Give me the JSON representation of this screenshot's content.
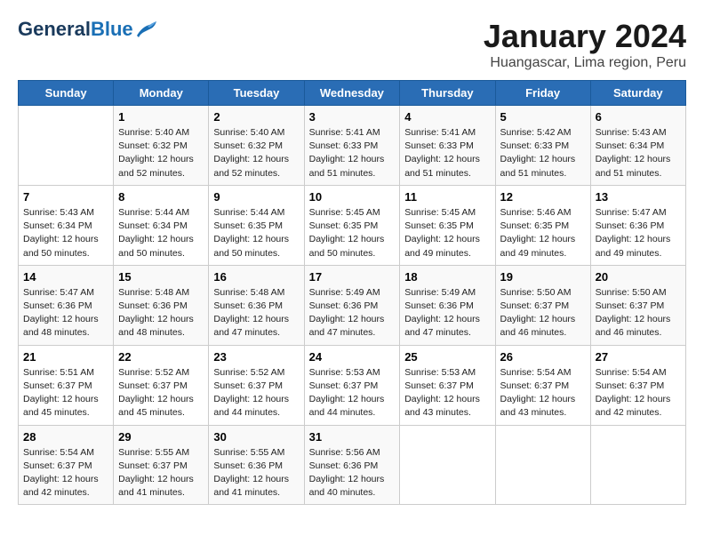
{
  "logo": {
    "line1": "General",
    "line2": "Blue"
  },
  "title": "January 2024",
  "subtitle": "Huangascar, Lima region, Peru",
  "days_of_week": [
    "Sunday",
    "Monday",
    "Tuesday",
    "Wednesday",
    "Thursday",
    "Friday",
    "Saturday"
  ],
  "weeks": [
    [
      {
        "num": "",
        "info": ""
      },
      {
        "num": "1",
        "info": "Sunrise: 5:40 AM\nSunset: 6:32 PM\nDaylight: 12 hours\nand 52 minutes."
      },
      {
        "num": "2",
        "info": "Sunrise: 5:40 AM\nSunset: 6:32 PM\nDaylight: 12 hours\nand 52 minutes."
      },
      {
        "num": "3",
        "info": "Sunrise: 5:41 AM\nSunset: 6:33 PM\nDaylight: 12 hours\nand 51 minutes."
      },
      {
        "num": "4",
        "info": "Sunrise: 5:41 AM\nSunset: 6:33 PM\nDaylight: 12 hours\nand 51 minutes."
      },
      {
        "num": "5",
        "info": "Sunrise: 5:42 AM\nSunset: 6:33 PM\nDaylight: 12 hours\nand 51 minutes."
      },
      {
        "num": "6",
        "info": "Sunrise: 5:43 AM\nSunset: 6:34 PM\nDaylight: 12 hours\nand 51 minutes."
      }
    ],
    [
      {
        "num": "7",
        "info": "Sunrise: 5:43 AM\nSunset: 6:34 PM\nDaylight: 12 hours\nand 50 minutes."
      },
      {
        "num": "8",
        "info": "Sunrise: 5:44 AM\nSunset: 6:34 PM\nDaylight: 12 hours\nand 50 minutes."
      },
      {
        "num": "9",
        "info": "Sunrise: 5:44 AM\nSunset: 6:35 PM\nDaylight: 12 hours\nand 50 minutes."
      },
      {
        "num": "10",
        "info": "Sunrise: 5:45 AM\nSunset: 6:35 PM\nDaylight: 12 hours\nand 50 minutes."
      },
      {
        "num": "11",
        "info": "Sunrise: 5:45 AM\nSunset: 6:35 PM\nDaylight: 12 hours\nand 49 minutes."
      },
      {
        "num": "12",
        "info": "Sunrise: 5:46 AM\nSunset: 6:35 PM\nDaylight: 12 hours\nand 49 minutes."
      },
      {
        "num": "13",
        "info": "Sunrise: 5:47 AM\nSunset: 6:36 PM\nDaylight: 12 hours\nand 49 minutes."
      }
    ],
    [
      {
        "num": "14",
        "info": "Sunrise: 5:47 AM\nSunset: 6:36 PM\nDaylight: 12 hours\nand 48 minutes."
      },
      {
        "num": "15",
        "info": "Sunrise: 5:48 AM\nSunset: 6:36 PM\nDaylight: 12 hours\nand 48 minutes."
      },
      {
        "num": "16",
        "info": "Sunrise: 5:48 AM\nSunset: 6:36 PM\nDaylight: 12 hours\nand 47 minutes."
      },
      {
        "num": "17",
        "info": "Sunrise: 5:49 AM\nSunset: 6:36 PM\nDaylight: 12 hours\nand 47 minutes."
      },
      {
        "num": "18",
        "info": "Sunrise: 5:49 AM\nSunset: 6:36 PM\nDaylight: 12 hours\nand 47 minutes."
      },
      {
        "num": "19",
        "info": "Sunrise: 5:50 AM\nSunset: 6:37 PM\nDaylight: 12 hours\nand 46 minutes."
      },
      {
        "num": "20",
        "info": "Sunrise: 5:50 AM\nSunset: 6:37 PM\nDaylight: 12 hours\nand 46 minutes."
      }
    ],
    [
      {
        "num": "21",
        "info": "Sunrise: 5:51 AM\nSunset: 6:37 PM\nDaylight: 12 hours\nand 45 minutes."
      },
      {
        "num": "22",
        "info": "Sunrise: 5:52 AM\nSunset: 6:37 PM\nDaylight: 12 hours\nand 45 minutes."
      },
      {
        "num": "23",
        "info": "Sunrise: 5:52 AM\nSunset: 6:37 PM\nDaylight: 12 hours\nand 44 minutes."
      },
      {
        "num": "24",
        "info": "Sunrise: 5:53 AM\nSunset: 6:37 PM\nDaylight: 12 hours\nand 44 minutes."
      },
      {
        "num": "25",
        "info": "Sunrise: 5:53 AM\nSunset: 6:37 PM\nDaylight: 12 hours\nand 43 minutes."
      },
      {
        "num": "26",
        "info": "Sunrise: 5:54 AM\nSunset: 6:37 PM\nDaylight: 12 hours\nand 43 minutes."
      },
      {
        "num": "27",
        "info": "Sunrise: 5:54 AM\nSunset: 6:37 PM\nDaylight: 12 hours\nand 42 minutes."
      }
    ],
    [
      {
        "num": "28",
        "info": "Sunrise: 5:54 AM\nSunset: 6:37 PM\nDaylight: 12 hours\nand 42 minutes."
      },
      {
        "num": "29",
        "info": "Sunrise: 5:55 AM\nSunset: 6:37 PM\nDaylight: 12 hours\nand 41 minutes."
      },
      {
        "num": "30",
        "info": "Sunrise: 5:55 AM\nSunset: 6:36 PM\nDaylight: 12 hours\nand 41 minutes."
      },
      {
        "num": "31",
        "info": "Sunrise: 5:56 AM\nSunset: 6:36 PM\nDaylight: 12 hours\nand 40 minutes."
      },
      {
        "num": "",
        "info": ""
      },
      {
        "num": "",
        "info": ""
      },
      {
        "num": "",
        "info": ""
      }
    ]
  ]
}
